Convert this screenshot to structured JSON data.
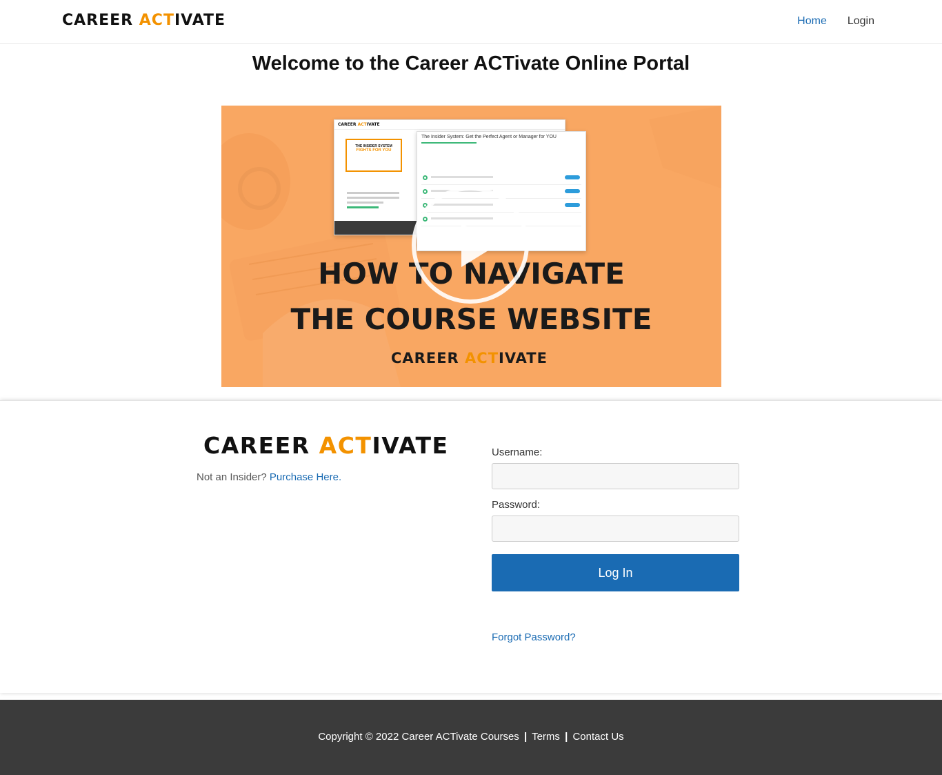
{
  "header": {
    "logo_part1": "CAREER ",
    "logo_accent": "ACT",
    "logo_part2": "IVATE",
    "nav": [
      {
        "label": "Home",
        "active": true
      },
      {
        "label": "Login",
        "active": false
      }
    ]
  },
  "main": {
    "title": "Welcome to the Career ACTivate Online Portal",
    "video": {
      "headline_line1": "HOW TO NAVIGATE",
      "headline_line2": "THE COURSE WEBSITE",
      "brand_part1": "CAREER ",
      "brand_accent": "ACT",
      "brand_part2": "IVATE",
      "screenshot_title": "The Insider System: Get the Perfect Agent or Manager for YOU",
      "card_line1": "THE INSIDER SYSTEM",
      "card_line2": "FIGHTS FOR YOU",
      "play_icon": "play-icon"
    }
  },
  "login_panel": {
    "logo_part1": "CAREER ",
    "logo_accent": "ACT",
    "logo_part2": "IVATE",
    "insider_text": "Not an Insider?",
    "purchase_link": "Purchase Here.",
    "username_label": "Username:",
    "username_value": "",
    "password_label": "Password:",
    "password_value": "",
    "login_button": "Log In",
    "forgot_link": "Forgot Password?"
  },
  "footer": {
    "copyright": "Copyright © 2022 Career ACTivate Courses",
    "separator": "|",
    "terms": "Terms",
    "contact": "Contact Us"
  },
  "colors": {
    "accent": "#f39200",
    "link": "#1a6bb3",
    "video_bg": "#f9a762",
    "footer_bg": "#3b3b3b"
  }
}
